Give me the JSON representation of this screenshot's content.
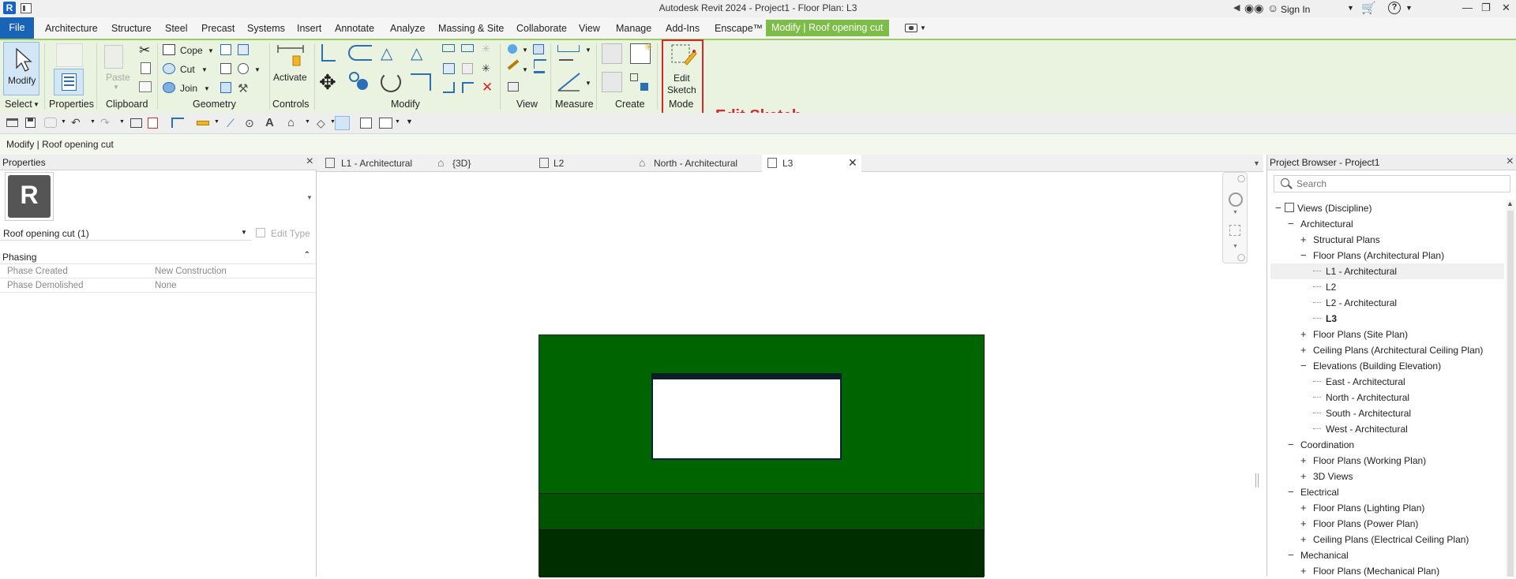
{
  "app": {
    "title": "Autodesk Revit 2024 - Project1 - Floor Plan: L3",
    "sign_in": "Sign In"
  },
  "menu": {
    "file": "File",
    "tabs": [
      "Architecture",
      "Structure",
      "Steel",
      "Precast",
      "Systems",
      "Insert",
      "Annotate",
      "Analyze",
      "Massing & Site",
      "Collaborate",
      "View",
      "Manage",
      "Add-Ins",
      "Enscape™"
    ],
    "context_tab": "Modify | Roof opening cut"
  },
  "ribbon": {
    "modify_label": "Modify",
    "select_label": "Select",
    "properties_label": "Properties",
    "paste_label": "Paste",
    "clipboard_label": "Clipboard",
    "cope_label": "Cope",
    "cut_label": "Cut",
    "join_label": "Join",
    "geometry_label": "Geometry",
    "activate_label": "Activate",
    "controls_label": "Controls",
    "modify_panel_label": "Modify",
    "view_label": "View",
    "measure_label": "Measure",
    "create_label": "Create",
    "edit_sketch_line1": "Edit",
    "edit_sketch_line2": "Sketch",
    "mode_label": "Mode"
  },
  "annotation": {
    "edit_sketch": "Edit Sketch"
  },
  "options_bar": {
    "text": "Modify | Roof opening cut"
  },
  "properties": {
    "header": "Properties",
    "type_selector": "Roof opening cut (1)",
    "edit_type": "Edit Type",
    "section": "Phasing",
    "rows": [
      {
        "name": "Phase Created",
        "value": "New Construction"
      },
      {
        "name": "Phase Demolished",
        "value": "None"
      }
    ]
  },
  "view_tabs": [
    {
      "label": "L1 - Architectural",
      "icon": "floor-plan-icon"
    },
    {
      "label": "{3D}",
      "icon": "house-icon"
    },
    {
      "label": "L2",
      "icon": "floor-plan-icon"
    },
    {
      "label": "North - Architectural",
      "icon": "elevation-icon"
    },
    {
      "label": "L3",
      "icon": "floor-plan-icon",
      "active": true
    }
  ],
  "browser": {
    "header": "Project Browser - Project1",
    "search_placeholder": "Search",
    "tree": [
      {
        "label": "Views (Discipline)",
        "toggle": "−"
      },
      {
        "label": "Architectural",
        "toggle": "−"
      },
      {
        "label": "Structural Plans",
        "toggle": "+"
      },
      {
        "label": "Floor Plans (Architectural Plan)",
        "toggle": "−"
      },
      {
        "label": "L1 - Architectural",
        "toggle": ""
      },
      {
        "label": "L2",
        "toggle": ""
      },
      {
        "label": "L2 - Architectural",
        "toggle": ""
      },
      {
        "label": "L3",
        "toggle": ""
      },
      {
        "label": "Floor Plans (Site Plan)",
        "toggle": "+"
      },
      {
        "label": "Ceiling Plans (Architectural Ceiling Plan)",
        "toggle": "+"
      },
      {
        "label": "Elevations (Building Elevation)",
        "toggle": "−"
      },
      {
        "label": "East - Architectural",
        "toggle": ""
      },
      {
        "label": "North - Architectural",
        "toggle": ""
      },
      {
        "label": "South - Architectural",
        "toggle": ""
      },
      {
        "label": "West - Architectural",
        "toggle": ""
      },
      {
        "label": "Coordination",
        "toggle": "−"
      },
      {
        "label": "Floor Plans (Working Plan)",
        "toggle": "+"
      },
      {
        "label": "3D Views",
        "toggle": "+"
      },
      {
        "label": "Electrical",
        "toggle": "−"
      },
      {
        "label": "Floor Plans (Lighting Plan)",
        "toggle": "+"
      },
      {
        "label": "Floor Plans (Power Plan)",
        "toggle": "+"
      },
      {
        "label": "Ceiling Plans (Electrical Ceiling Plan)",
        "toggle": "+"
      },
      {
        "label": "Mechanical",
        "toggle": "−"
      },
      {
        "label": "Floor Plans (Mechanical Plan)",
        "toggle": "+"
      }
    ]
  },
  "colors": {
    "accent_green": "#7cbd47",
    "file_blue": "#1a64b8",
    "ribbon_bg": "#eaf3e0",
    "roof_green": "#006400",
    "highlight_red": "#d62828"
  }
}
